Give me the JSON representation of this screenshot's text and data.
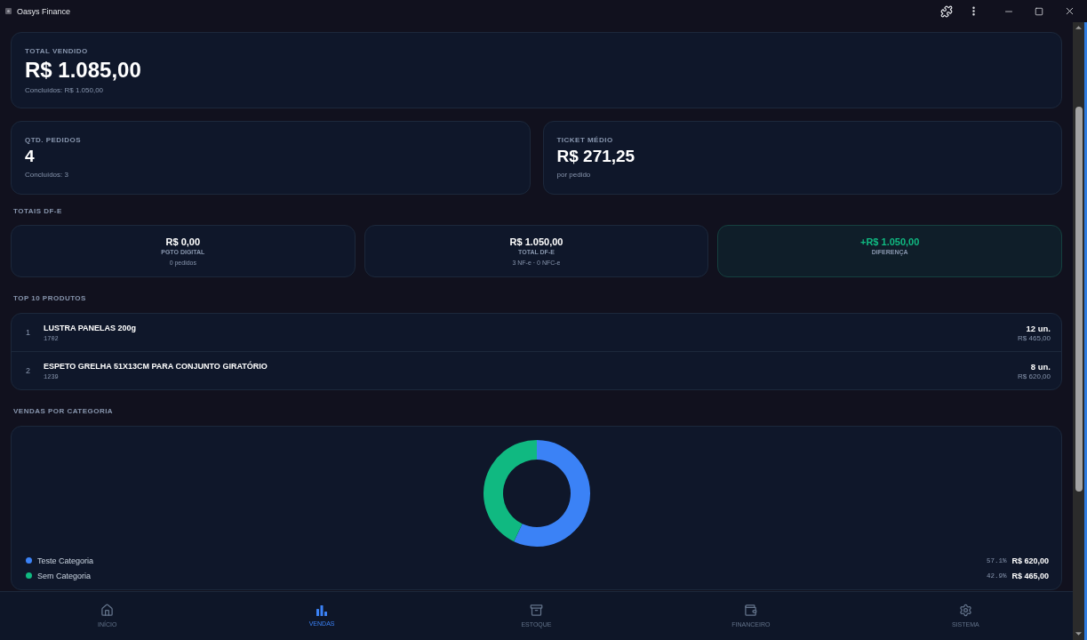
{
  "window": {
    "title": "Oasys Finance"
  },
  "summary": {
    "label": "TOTAL VENDIDO",
    "value": "R$ 1.085,00",
    "note": "Concluídos: R$ 1.050,00"
  },
  "stats": [
    {
      "label": "QTD. PEDIDOS",
      "value": "4",
      "note": "Concluídos: 3"
    },
    {
      "label": "TICKET MÉDIO",
      "value": "R$ 271,25",
      "note": "por pedido"
    }
  ],
  "dfe_totals": {
    "title": "TOTAIS DF-E",
    "cards": [
      {
        "value": "R$ 0,00",
        "label": "PGTO DIGITAL",
        "note": "0 pedidos",
        "highlight": false
      },
      {
        "value": "R$ 1.050,00",
        "label": "TOTAL DF-E",
        "note": "3 NF-e · 0 NFC-e",
        "highlight": false
      },
      {
        "value": "+R$ 1.050,00",
        "label": "DIFERENÇA",
        "highlight": true
      }
    ]
  },
  "top_products": {
    "title": "TOP 10 PRODUTOS",
    "rows": [
      {
        "rank": "1",
        "name": "LUSTRA PANELAS 200g",
        "code": "1702",
        "quantity": "12 un.",
        "amount": "R$ 465,00"
      },
      {
        "rank": "2",
        "name": "ESPETO GRELHA 51X13CM PARA CONJUNTO GIRATÓRIO",
        "code": "1239",
        "quantity": "8 un.",
        "amount": "R$ 620,00"
      }
    ]
  },
  "category_sales": {
    "title": "VENDAS POR CATEGORIA",
    "chart_data": {
      "type": "donut",
      "categories": [
        "Teste Categoria",
        "Sem Categoria"
      ],
      "values": [
        57.1,
        42.9
      ]
    },
    "legend": [
      {
        "color": "#3b82f6",
        "percent": "57.1%",
        "amount": "R$ 620,00"
      },
      {
        "color": "#10b981",
        "percent": "42.9%",
        "amount": "R$ 465,00"
      }
    ]
  },
  "bottom_nav": [
    {
      "label": "INÍCIO",
      "selected": false
    },
    {
      "label": "VENDAS",
      "selected": true
    },
    {
      "label": "ESTOQUE",
      "selected": false
    },
    {
      "label": "FINANCEIRO",
      "selected": false
    },
    {
      "label": "SISTEMA",
      "selected": false
    }
  ]
}
